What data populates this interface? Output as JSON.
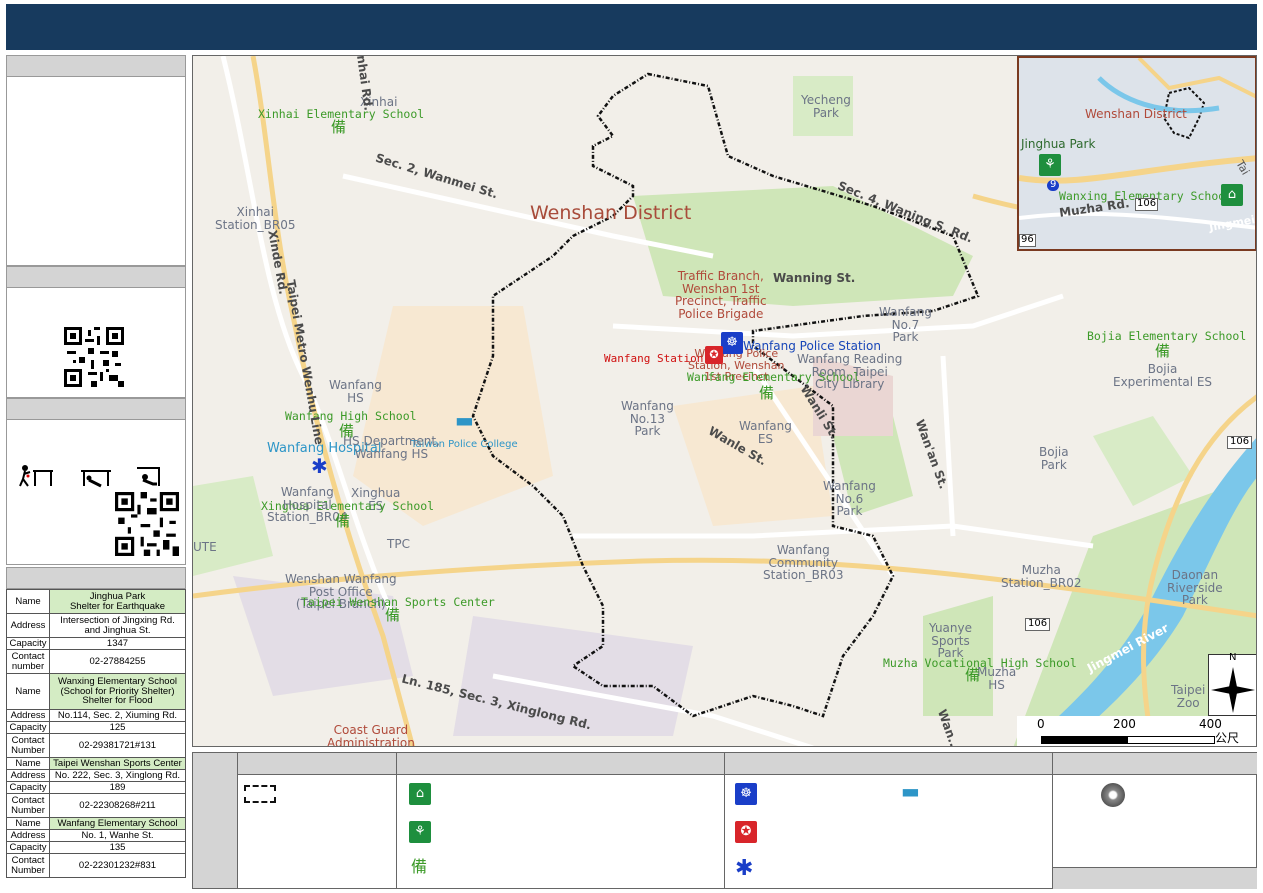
{
  "map": {
    "district_label": "Wenshan District",
    "labels": {
      "xinhai_es": "Xinhai Elementary School",
      "xinhai": "Xinhai",
      "xinhai_station": "Xinhai\nStation_BR05",
      "yecheng_park": "Yecheng\nPark",
      "traffic_branch": "Traffic Branch,\nWenshan 1st\nPrecinct, Traffic\nPolice Brigade",
      "wanfang_no7": "Wanfang\nNo.7\nPark",
      "wanfang_police": "Wanfang Police Station",
      "wanfang_station": "Wanfang Station",
      "wanfang_police2": "Wanfang Police\nStation, Wenshan\n1st Precinct",
      "wanfang_es": "Wanfang Elementary School",
      "wanfang_reading": "Wanfang Reading\nRoom, Taipei\nCity Library",
      "bojia_es": "Bojia Elementary School",
      "bojia_exp": "Bojia\nExperimental ES",
      "wanfang_hs_top": "Wanfang\nHS",
      "wanfang_high": "Wanfang High School",
      "taiwan_police": "Taiwan Police College",
      "wanfang_hospital": "Wanfang Hospital",
      "wanfang_hs_dept": "HS Department,\nWanfang HS",
      "wanfang_no13": "Wanfang\nNo.13\nPark",
      "wanfang_es2": "Wanfang\nES",
      "bojia_park": "Bojia\nPark",
      "wanfang_no6": "Wanfang\nNo.6\nPark",
      "xinghua": "Xinghua\nES",
      "xinghua_es": "Xinghua Elementary School",
      "wanfang_hospital_station": "Wanfang\nHospital\nStation_BR04",
      "tpc": "TPC",
      "wanfang_community": "Wanfang\nCommunity\nStation_BR03",
      "muzha_station": "Muzha\nStation_BR02",
      "daonan": "Daonan\nRiverside\nPark",
      "wenshan_wanfang_po": "Wenshan Wanfang\nPost Office\n(Taipei Branch)",
      "sports_center": "Taipei Wenshan Sports Center",
      "yuanye": "Yuanye\nSports\nPark",
      "muzha_vocational": "Muzha Vocational High School",
      "muzha_hs": "Muzha\nHS",
      "taipei_zoo": "Taipei\nZoo",
      "coast_guard": "Coast Guard\nAdministration",
      "jingmei_river": "Jingmei River",
      "ute": "UTE"
    },
    "roads": {
      "xinhai_rd": "Xinhai Rd.",
      "wanmei": "Sec. 2, Wanmei St.",
      "wanning_sec": "Sec. 4, Waning S. Rd.",
      "wanning": "Wanning St.",
      "xinglong": "Ln. 185, Sec. 3, Xinglong Rd.",
      "wanle": "Wanle St.",
      "wanli": "Wanli St.",
      "wanan": "Wan'an St.",
      "xinde": "Xinde Rd.",
      "metro": "Taipei Metro Wenhu Line",
      "wanfu": "Wan...",
      "route106a": "106",
      "route106b": "106"
    },
    "inset": {
      "wenshan": "Wenshan District",
      "jinghua": "Jinghua Park",
      "wanxing": "Wanxing Elementary School",
      "muzha_rd": "Muzha Rd.",
      "jingmei": "Jingmei",
      "tai": "Tai",
      "r106": "106",
      "r96": "96",
      "r9": "9"
    },
    "scale": {
      "t0": "0",
      "t1": "200",
      "t2": "400",
      "unit": "公尺"
    },
    "compass_n": "N"
  },
  "shelters": [
    {
      "name": "Jinghua Park\nShelter for Earthquake",
      "address": "Intersection of Jingxing Rd.\nand Jinghua St.",
      "capacity": "1347",
      "contact": "02-27884255"
    },
    {
      "name": "Wanxing Elementary School\n(School for Priority Shelter)\nShelter for Flood",
      "address": "No.114, Sec. 2, Xiuming Rd.",
      "capacity": "125",
      "contact": "02-29381721#131"
    },
    {
      "name": "Taipei Wenshan Sports Center",
      "address": "No. 222, Sec. 3, Xinglong Rd.",
      "capacity": "189",
      "contact": "02-22308268#211"
    },
    {
      "name": "Wanfang Elementary School",
      "address": "No. 1, Wanhe St.",
      "capacity": "135",
      "contact": "02-22301232#831"
    }
  ],
  "table_keys": {
    "name": "Name",
    "address": "Address",
    "capacity": "Capacity",
    "contact1": "Contact\nnumber",
    "contact2": "Contact\nNumber"
  },
  "colors": {
    "title_bar": "#173a5e",
    "shelter_green": "#1e8f3e",
    "police_blue": "#1a3ec8",
    "fire_red": "#d8252a",
    "boundary": "#111111"
  }
}
